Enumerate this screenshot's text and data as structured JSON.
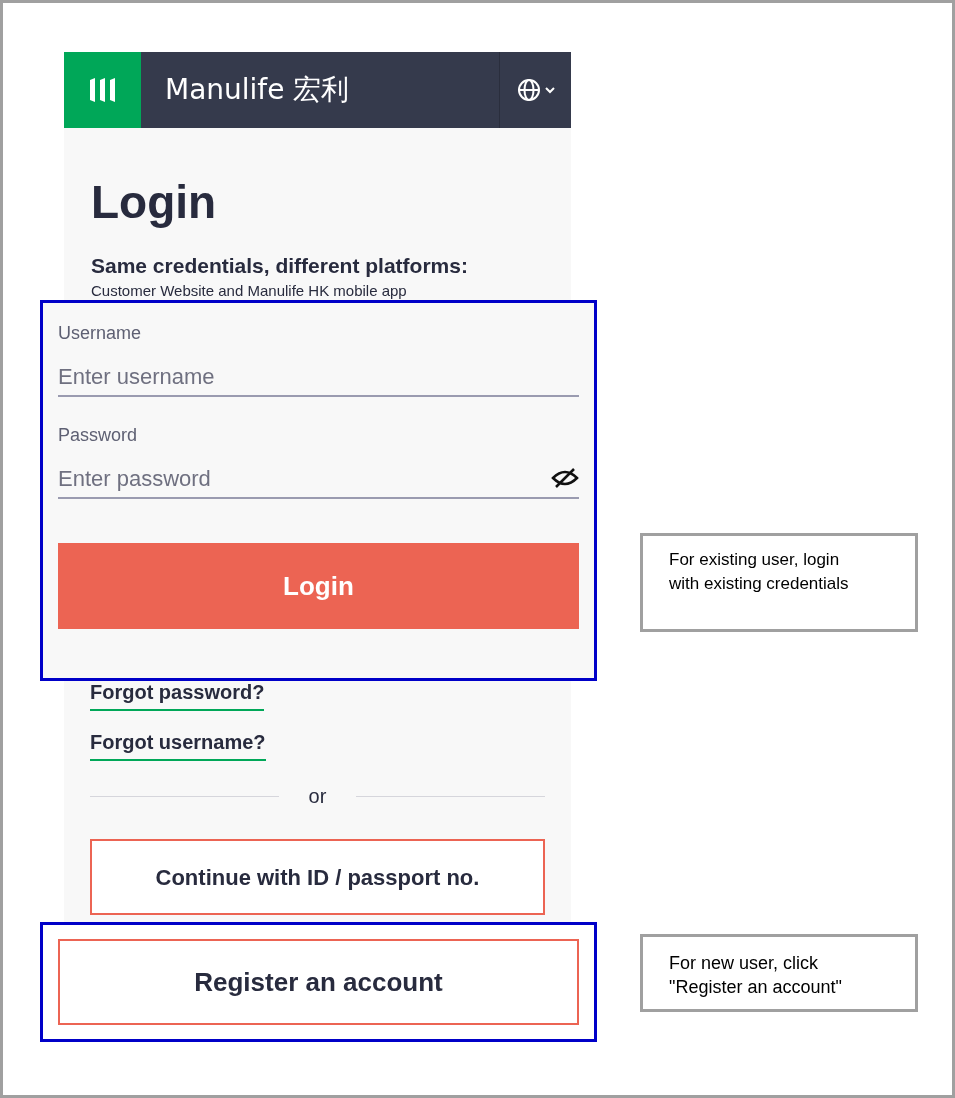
{
  "header": {
    "brand": "Manulife 宏利"
  },
  "title": "Login",
  "subtitle": "Same credentials, different platforms:",
  "description": "Customer Website and Manulife HK mobile app",
  "fields": [
    {
      "kind": "text",
      "label": "Username",
      "placeholder": "Enter username"
    },
    {
      "kind": "password",
      "label": "Password",
      "placeholder": "Enter password"
    }
  ],
  "login_button": "Login",
  "links": [
    "Forgot password?",
    "Forgot username?"
  ],
  "divider_text": "or",
  "secondary_button": "Continue with ID / passport no.",
  "register_button": "Register an account",
  "annotations": [
    "For existing user, login with existing credentials",
    "For new user, click \"Register an account\""
  ]
}
